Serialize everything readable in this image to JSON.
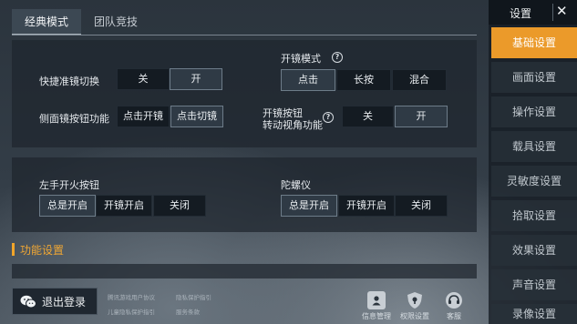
{
  "tabs": [
    "经典模式",
    "团队竞技"
  ],
  "panel1": {
    "quick_scope": {
      "label": "快捷准镜切换",
      "options": [
        "关",
        "开"
      ]
    },
    "side_scope": {
      "label": "侧面镜按钮功能",
      "options": [
        "点击开镜",
        "点击切镜"
      ]
    },
    "scope_mode": {
      "label": "开镜模式",
      "options": [
        "点击",
        "长按",
        "混合"
      ]
    },
    "scope_view": {
      "label_line1": "开镜按钮",
      "label_line2": "转动视角功能",
      "options": [
        "关",
        "开"
      ]
    }
  },
  "panel2": {
    "left_fire": {
      "label": "左手开火按钮",
      "options": [
        "总是开启",
        "开镜开启",
        "关闭"
      ]
    },
    "gyro": {
      "label": "陀螺仪",
      "options": [
        "总是开启",
        "开镜开启",
        "关闭"
      ]
    }
  },
  "section_title": "功能设置",
  "bottom": {
    "logout": "退出登录",
    "links": [
      "腾讯游戏用户协议",
      "隐私保护指引",
      "儿童隐私保护指引",
      "服务条款"
    ],
    "icons": [
      {
        "label": "信息管理",
        "icon": "id-card-icon"
      },
      {
        "label": "权限设置",
        "icon": "shield-icon"
      },
      {
        "label": "客服",
        "icon": "headset-icon"
      }
    ]
  },
  "sidebar": {
    "title": "设置",
    "close": "✕",
    "items": [
      "基础设置",
      "画面设置",
      "操作设置",
      "载具设置",
      "灵敏度设置",
      "拾取设置",
      "效果设置",
      "声音设置",
      "录像设置"
    ]
  },
  "colors": {
    "accent": "#eb9a2a",
    "section": "#f0a734"
  }
}
